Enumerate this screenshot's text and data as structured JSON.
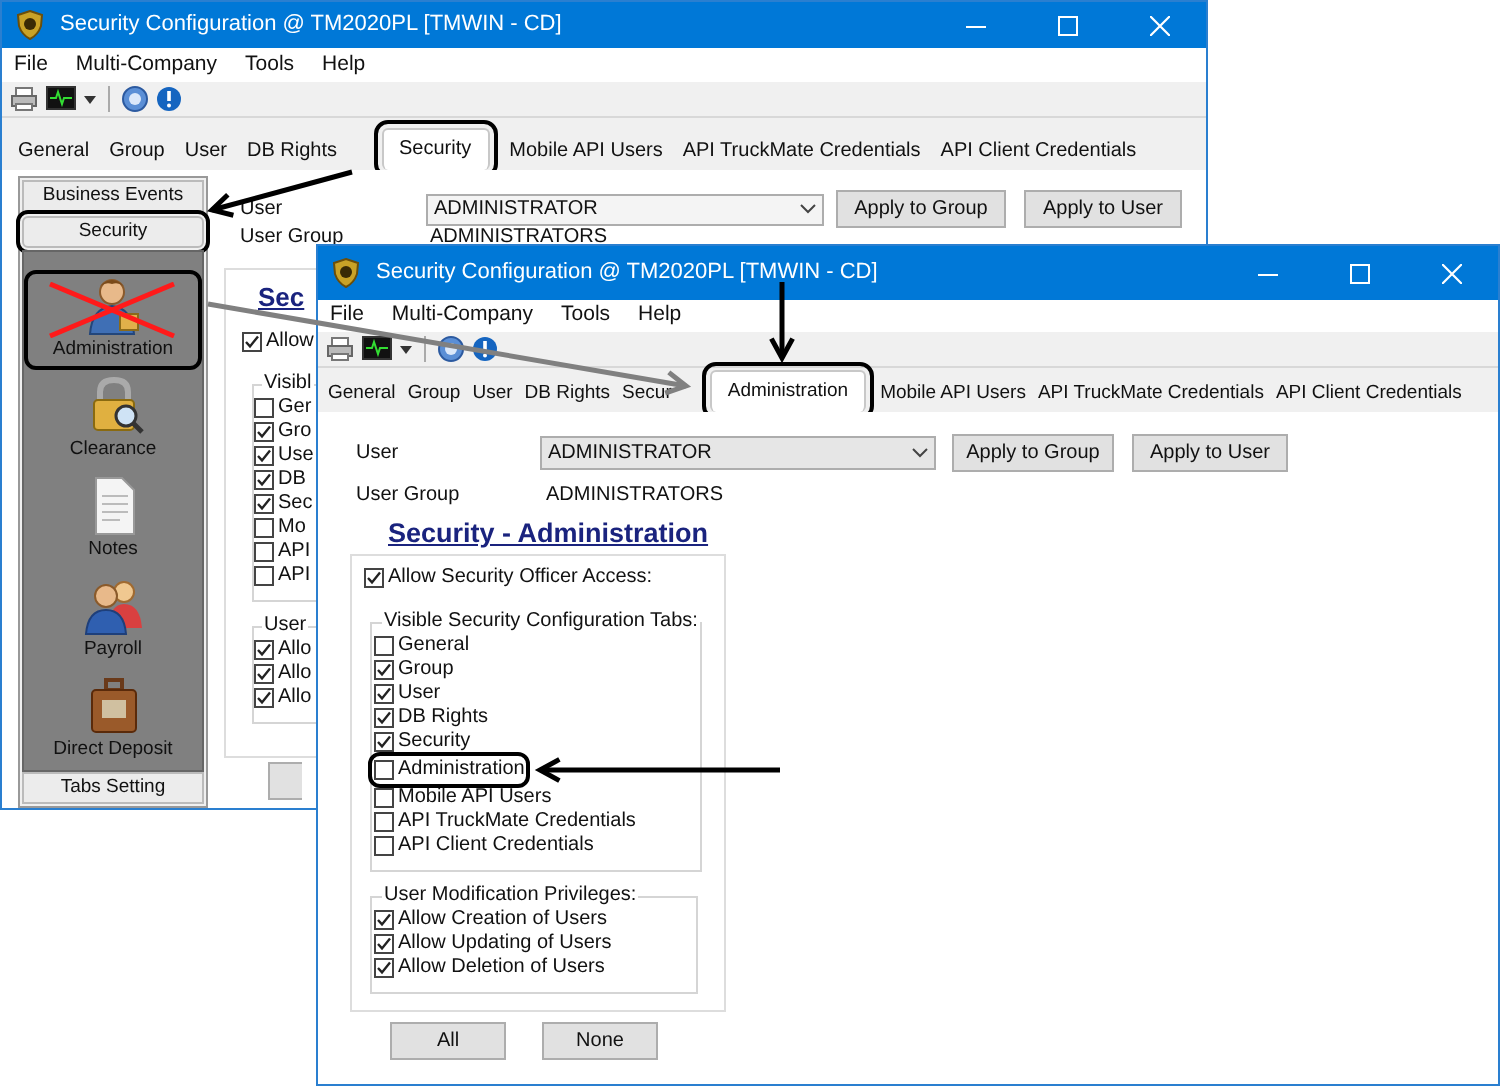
{
  "back_window": {
    "title": "Security Configuration @ TM2020PL [TMWIN - CD]",
    "menu": [
      "File",
      "Multi-Company",
      "Tools",
      "Help"
    ],
    "tabs": [
      {
        "label": "General",
        "selected": false
      },
      {
        "label": "Group",
        "selected": false
      },
      {
        "label": "User",
        "selected": false
      },
      {
        "label": "DB Rights",
        "selected": false
      },
      {
        "label": "Security",
        "selected": true
      },
      {
        "label": "Mobile API Users",
        "selected": false
      },
      {
        "label": "API TruckMate Credentials",
        "selected": false
      },
      {
        "label": "API Client Credentials",
        "selected": false
      }
    ],
    "sidebar": {
      "buttons": [
        {
          "label": "Business Events",
          "highlighted": false
        },
        {
          "label": "Security",
          "highlighted": true
        }
      ],
      "items": [
        {
          "label": "Administration",
          "kind": "person",
          "crossed_out": true
        },
        {
          "label": "Clearance",
          "kind": "padlock",
          "crossed_out": false
        },
        {
          "label": "Notes",
          "kind": "document",
          "crossed_out": false
        },
        {
          "label": "Payroll",
          "kind": "people",
          "crossed_out": false
        },
        {
          "label": "Direct Deposit",
          "kind": "briefcase",
          "crossed_out": false
        }
      ],
      "footer": "Tabs Setting"
    },
    "user": {
      "label": "User",
      "value": "ADMINISTRATOR"
    },
    "buttons": [
      "Apply to Group",
      "Apply to User"
    ],
    "user_group": {
      "label": "User Group",
      "value": "ADMINISTRATORS"
    },
    "heading": "Sec",
    "officer_access": {
      "label": "Allow",
      "checked": true
    },
    "visible_tabs": {
      "title": "Visibl",
      "items": [
        {
          "label": "Ger",
          "checked": false
        },
        {
          "label": "Gro",
          "checked": true
        },
        {
          "label": "Use",
          "checked": true
        },
        {
          "label": "DB",
          "checked": true
        },
        {
          "label": "Sec",
          "checked": true
        },
        {
          "label": "Mo",
          "checked": false
        },
        {
          "label": "API",
          "checked": false
        },
        {
          "label": "API",
          "checked": false
        }
      ]
    },
    "privileges": {
      "title": "User",
      "items": [
        {
          "label": "Allo",
          "checked": true
        },
        {
          "label": "Allo",
          "checked": true
        },
        {
          "label": "Allo",
          "checked": true
        }
      ]
    }
  },
  "front_window": {
    "title": "Security Configuration @ TM2020PL [TMWIN - CD]",
    "menu": [
      "File",
      "Multi-Company",
      "Tools",
      "Help"
    ],
    "tabs": [
      {
        "label": "General",
        "selected": false
      },
      {
        "label": "Group",
        "selected": false
      },
      {
        "label": "User",
        "selected": false
      },
      {
        "label": "DB Rights",
        "selected": false
      },
      {
        "label": "Secur",
        "selected": false
      },
      {
        "label": "Administration",
        "selected": true
      },
      {
        "label": "Mobile API Users",
        "selected": false
      },
      {
        "label": "API TruckMate Credentials",
        "selected": false
      },
      {
        "label": "API Client Credentials",
        "selected": false
      }
    ],
    "user": {
      "label": "User",
      "value": "ADMINISTRATOR"
    },
    "buttons": [
      "Apply to Group",
      "Apply to User"
    ],
    "user_group": {
      "label": "User Group",
      "value": "ADMINISTRATORS"
    },
    "heading": "Security - Administration",
    "officer_access": {
      "label": "Allow Security Officer Access:",
      "checked": true
    },
    "visible_tabs": {
      "title": "Visible Security Configuration Tabs:",
      "items": [
        {
          "label": "General",
          "checked": false,
          "highlighted": false
        },
        {
          "label": "Group",
          "checked": true,
          "highlighted": false
        },
        {
          "label": "User",
          "checked": true,
          "highlighted": false
        },
        {
          "label": "DB Rights",
          "checked": true,
          "highlighted": false
        },
        {
          "label": "Security",
          "checked": true,
          "highlighted": false
        },
        {
          "label": "Administration",
          "checked": false,
          "highlighted": true
        },
        {
          "label": "Mobile API Users",
          "checked": false,
          "highlighted": false
        },
        {
          "label": "API TruckMate Credentials",
          "checked": false,
          "highlighted": false
        },
        {
          "label": "API Client Credentials",
          "checked": false,
          "highlighted": false
        }
      ]
    },
    "privileges": {
      "title": "User Modification Privileges:",
      "items": [
        {
          "label": "Allow Creation of Users",
          "checked": true
        },
        {
          "label": "Allow Updating of Users",
          "checked": true
        },
        {
          "label": "Allow Deletion of Users",
          "checked": true
        }
      ]
    },
    "footer_buttons": [
      "All",
      "None"
    ]
  }
}
